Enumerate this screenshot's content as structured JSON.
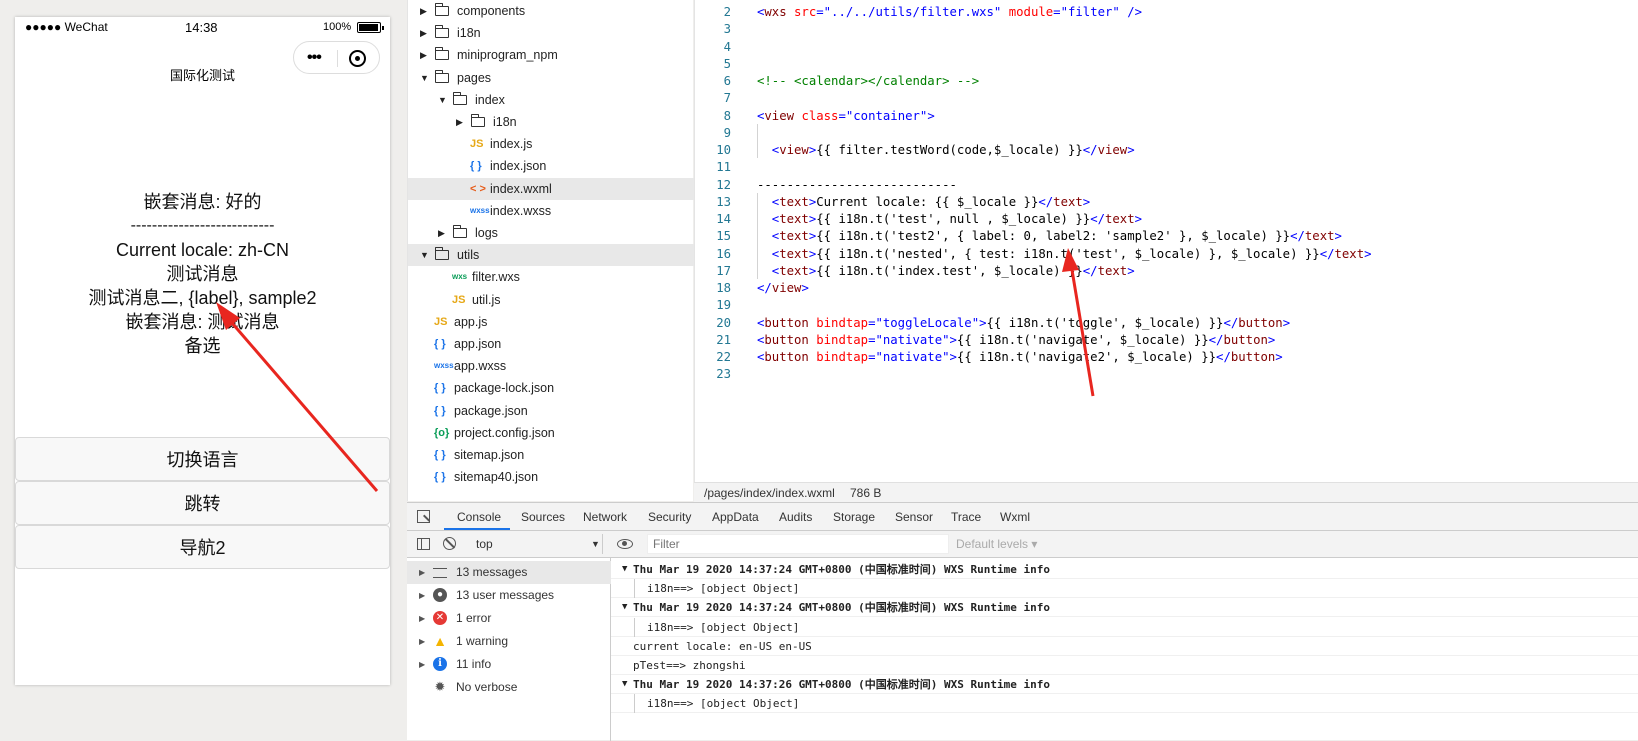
{
  "simulator": {
    "status": {
      "carrier": "●●●●● WeChat",
      "time": "14:38",
      "battery": "100%"
    },
    "nav_title": "国际化测试",
    "capsule": {
      "more": "•••",
      "close": "⊙"
    },
    "lines": [
      "嵌套消息: 好的",
      "---------------------------",
      "Current locale: zh-CN",
      "测试消息",
      "测试消息二, {label}, sample2",
      "嵌套消息: 测试消息",
      "备选"
    ],
    "buttons": [
      "切换语言",
      "跳转",
      "导航2"
    ]
  },
  "tree": {
    "items": [
      {
        "label": "components",
        "type": "folder",
        "expanded": false,
        "depth": 0
      },
      {
        "label": "i18n",
        "type": "folder",
        "expanded": false,
        "depth": 0
      },
      {
        "label": "miniprogram_npm",
        "type": "folder",
        "expanded": false,
        "depth": 0
      },
      {
        "label": "pages",
        "type": "folder",
        "expanded": true,
        "depth": 0
      },
      {
        "label": "index",
        "type": "folder",
        "expanded": true,
        "depth": 1
      },
      {
        "label": "i18n",
        "type": "folder",
        "expanded": false,
        "depth": 2
      },
      {
        "label": "index.js",
        "type": "js",
        "depth": 2
      },
      {
        "label": "index.json",
        "type": "json",
        "depth": 2
      },
      {
        "label": "index.wxml",
        "type": "wxml",
        "depth": 2,
        "selected": true
      },
      {
        "label": "index.wxss",
        "type": "wxss",
        "depth": 2
      },
      {
        "label": "logs",
        "type": "folder",
        "expanded": false,
        "depth": 1
      },
      {
        "label": "utils",
        "type": "folder",
        "expanded": true,
        "depth": 0,
        "highlight": true
      },
      {
        "label": "filter.wxs",
        "type": "wxs",
        "depth": 1
      },
      {
        "label": "util.js",
        "type": "js",
        "depth": 1
      },
      {
        "label": "app.js",
        "type": "js",
        "depth": 0
      },
      {
        "label": "app.json",
        "type": "json",
        "depth": 0
      },
      {
        "label": "app.wxss",
        "type": "wxss",
        "depth": 0
      },
      {
        "label": "package-lock.json",
        "type": "json",
        "depth": 0
      },
      {
        "label": "package.json",
        "type": "json",
        "depth": 0
      },
      {
        "label": "project.config.json",
        "type": "config",
        "depth": 0
      },
      {
        "label": "sitemap.json",
        "type": "json",
        "depth": 0
      },
      {
        "label": "sitemap40.json",
        "type": "json",
        "depth": 0
      }
    ],
    "icons": {
      "js": "JS",
      "json": "{ }",
      "wxml": "< >",
      "wxss": "wxss",
      "wxs": "wxs",
      "config": "{o}"
    }
  },
  "editor": {
    "lines": [
      {
        "n": "2",
        "t": [
          [
            "pun",
            "<"
          ],
          [
            "tag",
            "wxs"
          ],
          [
            "pun",
            " "
          ],
          [
            "attr",
            "src"
          ],
          [
            "pun",
            "="
          ],
          [
            "str",
            "\"../../utils/filter.wxs\""
          ],
          [
            "pun",
            " "
          ],
          [
            "attr",
            "module"
          ],
          [
            "pun",
            "="
          ],
          [
            "str",
            "\"filter\""
          ],
          [
            "pun",
            " />"
          ]
        ]
      },
      {
        "n": "3",
        "t": []
      },
      {
        "n": "4",
        "t": []
      },
      {
        "n": "5",
        "t": []
      },
      {
        "n": "6",
        "t": [
          [
            "com",
            "<!-- <calendar></calendar> -->"
          ]
        ]
      },
      {
        "n": "7",
        "t": []
      },
      {
        "n": "8",
        "t": [
          [
            "pun",
            "<"
          ],
          [
            "tag",
            "view"
          ],
          [
            "pun",
            " "
          ],
          [
            "attr",
            "class"
          ],
          [
            "pun",
            "="
          ],
          [
            "str",
            "\"container\""
          ],
          [
            "pun",
            ">"
          ]
        ]
      },
      {
        "n": "9",
        "t": []
      },
      {
        "n": "10",
        "t": [
          [
            "pun",
            "  <"
          ],
          [
            "tag",
            "view"
          ],
          [
            "pun",
            ">"
          ],
          [
            "txt",
            "{{ filter.testWord(code,$_locale) }}"
          ],
          [
            "pun",
            "</"
          ],
          [
            "tag",
            "view"
          ],
          [
            "pun",
            ">"
          ]
        ]
      },
      {
        "n": "11",
        "t": []
      },
      {
        "n": "12",
        "t": [
          [
            "txt",
            "---------------------------"
          ]
        ]
      },
      {
        "n": "13",
        "t": [
          [
            "pun",
            "  <"
          ],
          [
            "tag",
            "text"
          ],
          [
            "pun",
            ">"
          ],
          [
            "txt",
            "Current locale: {{ $_locale }}"
          ],
          [
            "pun",
            "</"
          ],
          [
            "tag",
            "text"
          ],
          [
            "pun",
            ">"
          ]
        ]
      },
      {
        "n": "14",
        "t": [
          [
            "pun",
            "  <"
          ],
          [
            "tag",
            "text"
          ],
          [
            "pun",
            ">"
          ],
          [
            "txt",
            "{{ i18n.t('test', null , $_locale) }}"
          ],
          [
            "pun",
            "</"
          ],
          [
            "tag",
            "text"
          ],
          [
            "pun",
            ">"
          ]
        ]
      },
      {
        "n": "15",
        "t": [
          [
            "pun",
            "  <"
          ],
          [
            "tag",
            "text"
          ],
          [
            "pun",
            ">"
          ],
          [
            "txt",
            "{{ i18n.t('test2', { label: 0, label2: 'sample2' }, $_locale) }}"
          ],
          [
            "pun",
            "</"
          ],
          [
            "tag",
            "text"
          ],
          [
            "pun",
            ">"
          ]
        ]
      },
      {
        "n": "16",
        "t": [
          [
            "pun",
            "  <"
          ],
          [
            "tag",
            "text"
          ],
          [
            "pun",
            ">"
          ],
          [
            "txt",
            "{{ i18n.t('nested', { test: i18n.t('test', $_locale) }, $_locale) }}"
          ],
          [
            "pun",
            "</"
          ],
          [
            "tag",
            "text"
          ],
          [
            "pun",
            ">"
          ]
        ]
      },
      {
        "n": "17",
        "t": [
          [
            "pun",
            "  <"
          ],
          [
            "tag",
            "text"
          ],
          [
            "pun",
            ">"
          ],
          [
            "txt",
            "{{ i18n.t('index.test', $_locale) }}"
          ],
          [
            "pun",
            "</"
          ],
          [
            "tag",
            "text"
          ],
          [
            "pun",
            ">"
          ]
        ]
      },
      {
        "n": "18",
        "t": [
          [
            "pun",
            "</"
          ],
          [
            "tag",
            "view"
          ],
          [
            "pun",
            ">"
          ]
        ]
      },
      {
        "n": "19",
        "t": []
      },
      {
        "n": "20",
        "t": [
          [
            "pun",
            "<"
          ],
          [
            "tag",
            "button"
          ],
          [
            "pun",
            " "
          ],
          [
            "attr",
            "bindtap"
          ],
          [
            "pun",
            "="
          ],
          [
            "str",
            "\"toggleLocale\""
          ],
          [
            "pun",
            ">"
          ],
          [
            "txt",
            "{{ i18n.t('toggle', $_locale) }}"
          ],
          [
            "pun",
            "</"
          ],
          [
            "tag",
            "button"
          ],
          [
            "pun",
            ">"
          ]
        ]
      },
      {
        "n": "21",
        "t": [
          [
            "pun",
            "<"
          ],
          [
            "tag",
            "button"
          ],
          [
            "pun",
            " "
          ],
          [
            "attr",
            "bindtap"
          ],
          [
            "pun",
            "="
          ],
          [
            "str",
            "\"nativate\""
          ],
          [
            "pun",
            ">"
          ],
          [
            "txt",
            "{{ i18n.t('navigate', $_locale) }}"
          ],
          [
            "pun",
            "</"
          ],
          [
            "tag",
            "button"
          ],
          [
            "pun",
            ">"
          ]
        ]
      },
      {
        "n": "22",
        "t": [
          [
            "pun",
            "<"
          ],
          [
            "tag",
            "button"
          ],
          [
            "pun",
            " "
          ],
          [
            "attr",
            "bindtap"
          ],
          [
            "pun",
            "="
          ],
          [
            "str",
            "\"nativate\""
          ],
          [
            "pun",
            ">"
          ],
          [
            "txt",
            "{{ i18n.t('navigate2', $_locale) }}"
          ],
          [
            "pun",
            "</"
          ],
          [
            "tag",
            "button"
          ],
          [
            "pun",
            ">"
          ]
        ]
      },
      {
        "n": "23",
        "t": []
      }
    ],
    "status_path": "/pages/index/index.wxml",
    "status_size": "786 B"
  },
  "devtools": {
    "tabs": [
      "Console",
      "Sources",
      "Network",
      "Security",
      "AppData",
      "Audits",
      "Storage",
      "Sensor",
      "Trace",
      "Wxml"
    ],
    "active_tab": "Console",
    "context": "top",
    "filter_placeholder": "Filter",
    "levels": "Default levels ▾",
    "sidebar": [
      {
        "label": "13 messages",
        "icon": "list"
      },
      {
        "label": "13 user messages",
        "icon": "user"
      },
      {
        "label": "1 error",
        "icon": "error"
      },
      {
        "label": "1 warning",
        "icon": "warn"
      },
      {
        "label": "11 info",
        "icon": "info"
      },
      {
        "label": "No verbose",
        "icon": "bug"
      }
    ],
    "logs": [
      {
        "kind": "head",
        "text": "Thu Mar 19 2020 14:37:24 GMT+0800 (中国标准时间) WXS Runtime info"
      },
      {
        "kind": "child",
        "text": "i18n==> [object Object]"
      },
      {
        "kind": "head",
        "text": "Thu Mar 19 2020 14:37:24 GMT+0800 (中国标准时间) WXS Runtime info"
      },
      {
        "kind": "child",
        "text": "i18n==> [object Object]"
      },
      {
        "kind": "plain",
        "text": "current locale: en-US en-US"
      },
      {
        "kind": "plain",
        "text": "pTest==> zhongshi"
      },
      {
        "kind": "head",
        "text": "Thu Mar 19 2020 14:37:26 GMT+0800 (中国标准时间) WXS Runtime info"
      },
      {
        "kind": "child",
        "text": "i18n==> [object Object]"
      }
    ]
  },
  "colors": {
    "arrow": "#e8261f",
    "accent": "#1a73e8"
  }
}
